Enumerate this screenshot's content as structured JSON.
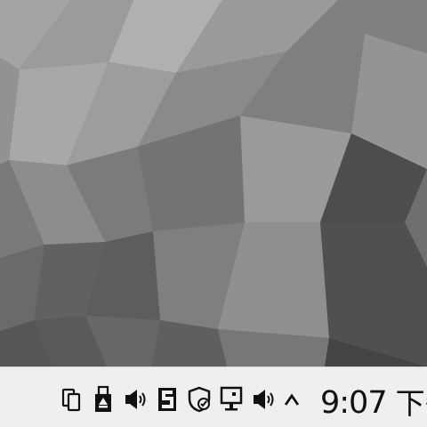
{
  "desktop": {
    "wallpaper": "gray-low-poly-wallpaper"
  },
  "taskbar": {
    "tray_icons": [
      "copy-devices-icon",
      "usb-drive-icon",
      "speaker-volume-icon",
      "s-app-icon",
      "shield-check-icon",
      "network-display-icon",
      "speaker-volume-icon",
      "chevron-up-icon"
    ],
    "clock": {
      "time": "9:07",
      "ampm": "下午"
    }
  },
  "colors": {
    "taskbar_bg": "#efefef",
    "wallpaper_base": "#6d6d6d",
    "text": "#111111"
  }
}
